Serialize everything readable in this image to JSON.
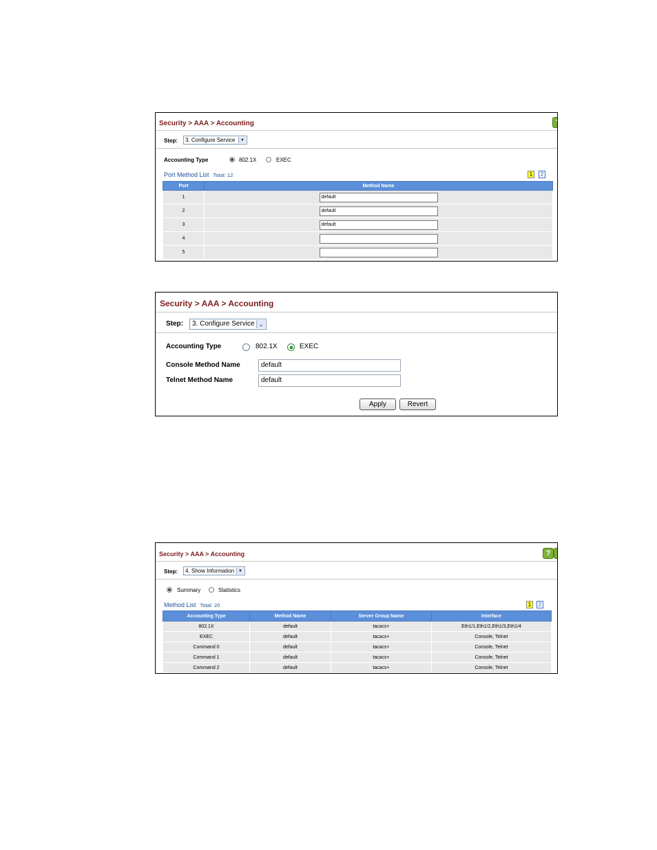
{
  "panel1": {
    "breadcrumb": [
      "Security",
      "AAA",
      "Accounting"
    ],
    "step_label": "Step:",
    "step_value": "3. Configure Service",
    "accounting_type_label": "Accounting Type",
    "radios": [
      {
        "label": "802.1X",
        "checked": true
      },
      {
        "label": "EXEC",
        "checked": false
      }
    ],
    "list_title": "Port Method List",
    "list_total": "Total: 12",
    "pages": [
      "1",
      "2"
    ],
    "columns": [
      "Port",
      "Method Name"
    ],
    "rows": [
      {
        "port": "1",
        "method": "default"
      },
      {
        "port": "2",
        "method": "default"
      },
      {
        "port": "3",
        "method": "default"
      },
      {
        "port": "4",
        "method": ""
      },
      {
        "port": "5",
        "method": ""
      }
    ]
  },
  "panel2": {
    "breadcrumb": [
      "Security",
      "AAA",
      "Accounting"
    ],
    "step_label": "Step:",
    "step_value": "3. Configure Service",
    "accounting_type_label": "Accounting Type",
    "radios": [
      {
        "label": "802.1X",
        "checked": false
      },
      {
        "label": "EXEC",
        "checked": true
      }
    ],
    "console_label": "Console Method Name",
    "console_value": "default",
    "telnet_label": "Telnet Method Name",
    "telnet_value": "default",
    "apply_label": "Apply",
    "revert_label": "Revert"
  },
  "panel3": {
    "breadcrumb": [
      "Security",
      "AAA",
      "Accounting"
    ],
    "step_label": "Step:",
    "step_value": "4. Show Information",
    "radios": [
      {
        "label": "Summary",
        "checked": true
      },
      {
        "label": "Statistics",
        "checked": false
      }
    ],
    "list_title": "Method List",
    "list_total": "Total: 20",
    "pages": [
      "1",
      "2"
    ],
    "columns": [
      "Accounting Type",
      "Method Name",
      "Server Group Name",
      "Interface"
    ],
    "rows": [
      [
        "802.1X",
        "default",
        "tacacs+",
        "Eth1/1,Eth1/2,Eth1/3,Eth1/4"
      ],
      [
        "EXEC",
        "default",
        "tacacs+",
        "Console, Telnet"
      ],
      [
        "Command 0",
        "default",
        "tacacs+",
        "Console, Telnet"
      ],
      [
        "Command 1",
        "default",
        "tacacs+",
        "Console, Telnet"
      ],
      [
        "Command 2",
        "default",
        "tacacs+",
        "Console, Telnet"
      ]
    ]
  },
  "colors": {
    "breadcrumb": "#7b1c1c",
    "table_header": "#5c8fd9",
    "list_title": "#1e4e9c",
    "current_page": "#ffff33",
    "help_icon": "#7fb03a"
  }
}
